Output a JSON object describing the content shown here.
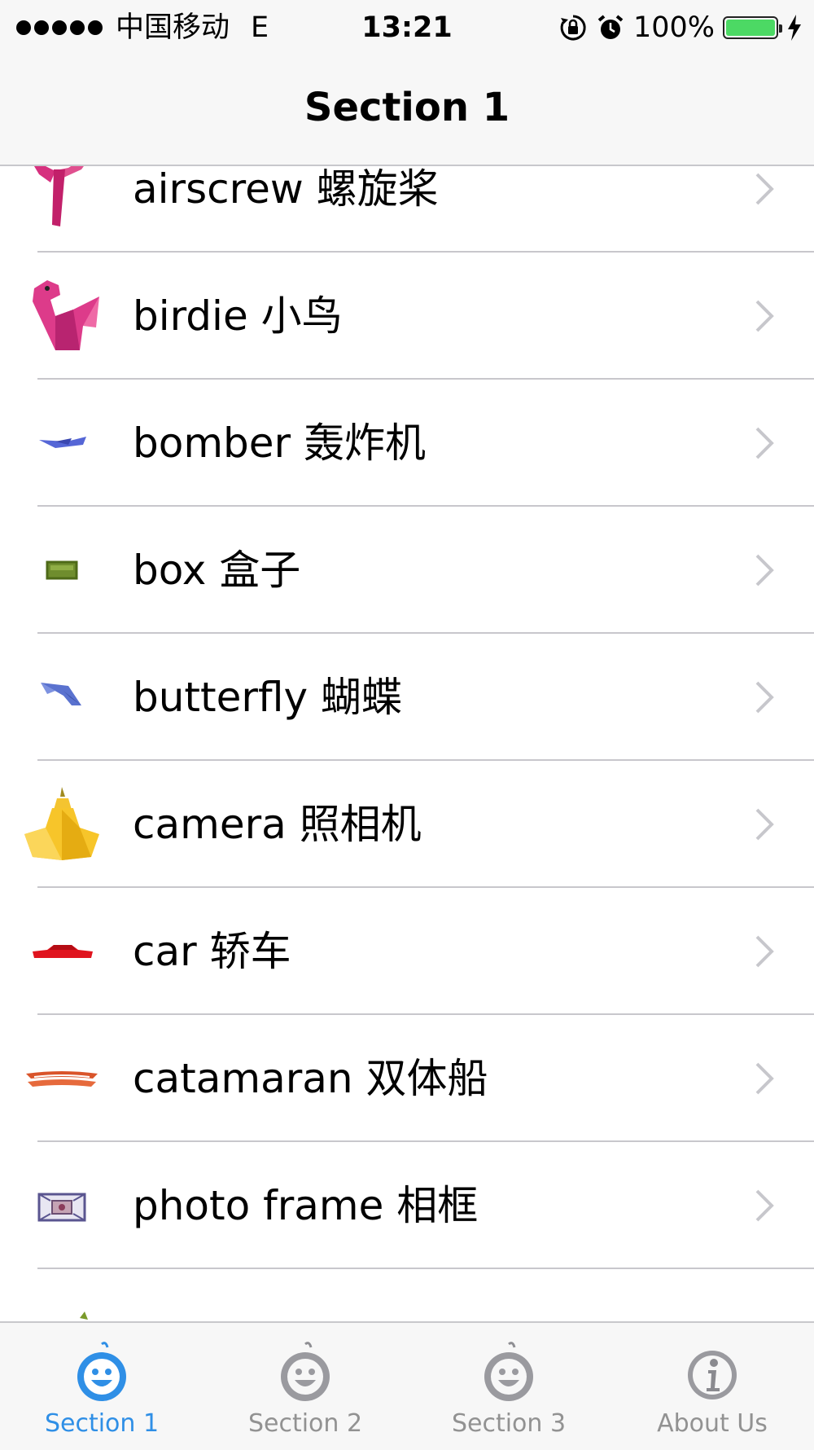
{
  "status_bar": {
    "carrier": "中国移动",
    "network": "E",
    "time": "13:21",
    "battery": "100%",
    "battery_color": "#4cd964"
  },
  "nav": {
    "title": "Section 1"
  },
  "list": {
    "items": [
      {
        "label": "airscrew 螺旋桨",
        "icon": "airscrew-origami-icon"
      },
      {
        "label": "birdie 小鸟",
        "icon": "birdie-origami-icon"
      },
      {
        "label": "bomber 轰炸机",
        "icon": "bomber-origami-icon"
      },
      {
        "label": "box 盒子",
        "icon": "box-origami-icon"
      },
      {
        "label": "butterfly 蝴蝶",
        "icon": "butterfly-origami-icon"
      },
      {
        "label": "camera 照相机",
        "icon": "camera-origami-icon"
      },
      {
        "label": "car 轿车",
        "icon": "car-origami-icon"
      },
      {
        "label": "catamaran 双体船",
        "icon": "catamaran-origami-icon"
      },
      {
        "label": "photo frame 相框",
        "icon": "photo-frame-origami-icon"
      }
    ]
  },
  "tabbar": {
    "active_color": "#2f8fe6",
    "tabs": [
      {
        "label": "Section 1",
        "icon": "smiley-icon",
        "active": true
      },
      {
        "label": "Section 2",
        "icon": "smiley-icon",
        "active": false
      },
      {
        "label": "Section 3",
        "icon": "smiley-icon",
        "active": false
      },
      {
        "label": "About Us",
        "icon": "info-icon",
        "active": false
      }
    ]
  }
}
